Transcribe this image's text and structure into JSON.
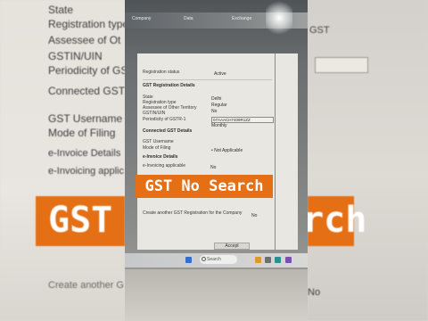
{
  "background_left": {
    "lines": [
      "State",
      "Registration type",
      "Assessee of Ot",
      "GSTIN/UIN",
      "Periodicity of GS",
      "Connected GST",
      "GST Username",
      "Mode of Filing",
      "e-Invoice Details",
      "e-Invoicing applic",
      "Create another G"
    ],
    "banner_text": "GST"
  },
  "background_right": {
    "banner_text": "arch",
    "bottom_value": "No",
    "header_value": "GST"
  },
  "screen": {
    "menu": [
      "Company",
      "Data",
      "Exchange"
    ],
    "rows": {
      "registration_status_label": "Registration status",
      "registration_status_value": "Active",
      "section_reg_details": "GST Registration Details",
      "state_label": "State",
      "state_value": "Delhi",
      "reg_type_label": "Registration type",
      "reg_type_value": "Regular",
      "assessee_label": "Assessee of Other Territory",
      "assessee_value": "No",
      "gstin_label": "GSTIN/UIN",
      "gstin_value": "07AAACH7409R1ZZ",
      "periodicity_label": "Periodicity of GSTR-1",
      "periodicity_value": "Monthly",
      "connected_label": "Connected GST Details",
      "username_label": "GST Username",
      "filing_label": "Mode of Filing",
      "filing_value": "• Not Applicable",
      "einvoice_label": "e-Invoice Details",
      "einvoicing_label": "e-Invoicing applicable",
      "einvoicing_value": "No",
      "create_another_label": "Create another GST Registration for the Company",
      "create_another_value": "No"
    },
    "accept_label": "Accept",
    "search_placeholder": "Search"
  },
  "overlay_title": "GST No Search",
  "colors": {
    "accent": "#e46f14"
  }
}
